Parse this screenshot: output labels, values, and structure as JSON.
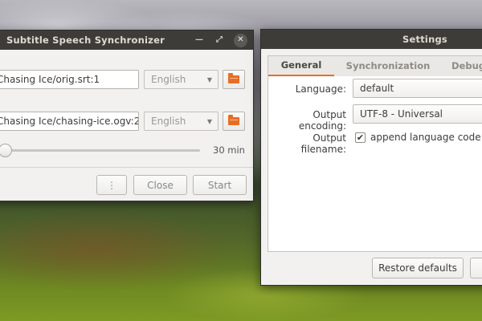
{
  "subtitle_window": {
    "title": "Subtitle Speech Synchronizer",
    "subtitle_path": "Chasing Ice/orig.srt:1",
    "subtitle_language": "English",
    "audio_label_fragment": ":",
    "audio_path": "Chasing Ice/chasing-ice.ogv:2",
    "audio_language": "English",
    "slider_value_label": "30 min",
    "slider_fraction": 0.02,
    "more_button": "⋮",
    "close_button": "Close",
    "start_button": "Start"
  },
  "settings_window": {
    "title": "Settings",
    "tabs": [
      "General",
      "Synchronization",
      "Debug"
    ],
    "active_tab": "General",
    "language_label": "Language:",
    "language_value": "default",
    "encoding_label": "Output encoding:",
    "encoding_value": "UTF-8 - Universal",
    "filename_label": "Output filename:",
    "append_language_checked": true,
    "append_language_label": "append language code",
    "restore_defaults_button": "Restore defaults"
  },
  "colors": {
    "accent": "#e66d26",
    "titlebar": "#3d3c38"
  }
}
